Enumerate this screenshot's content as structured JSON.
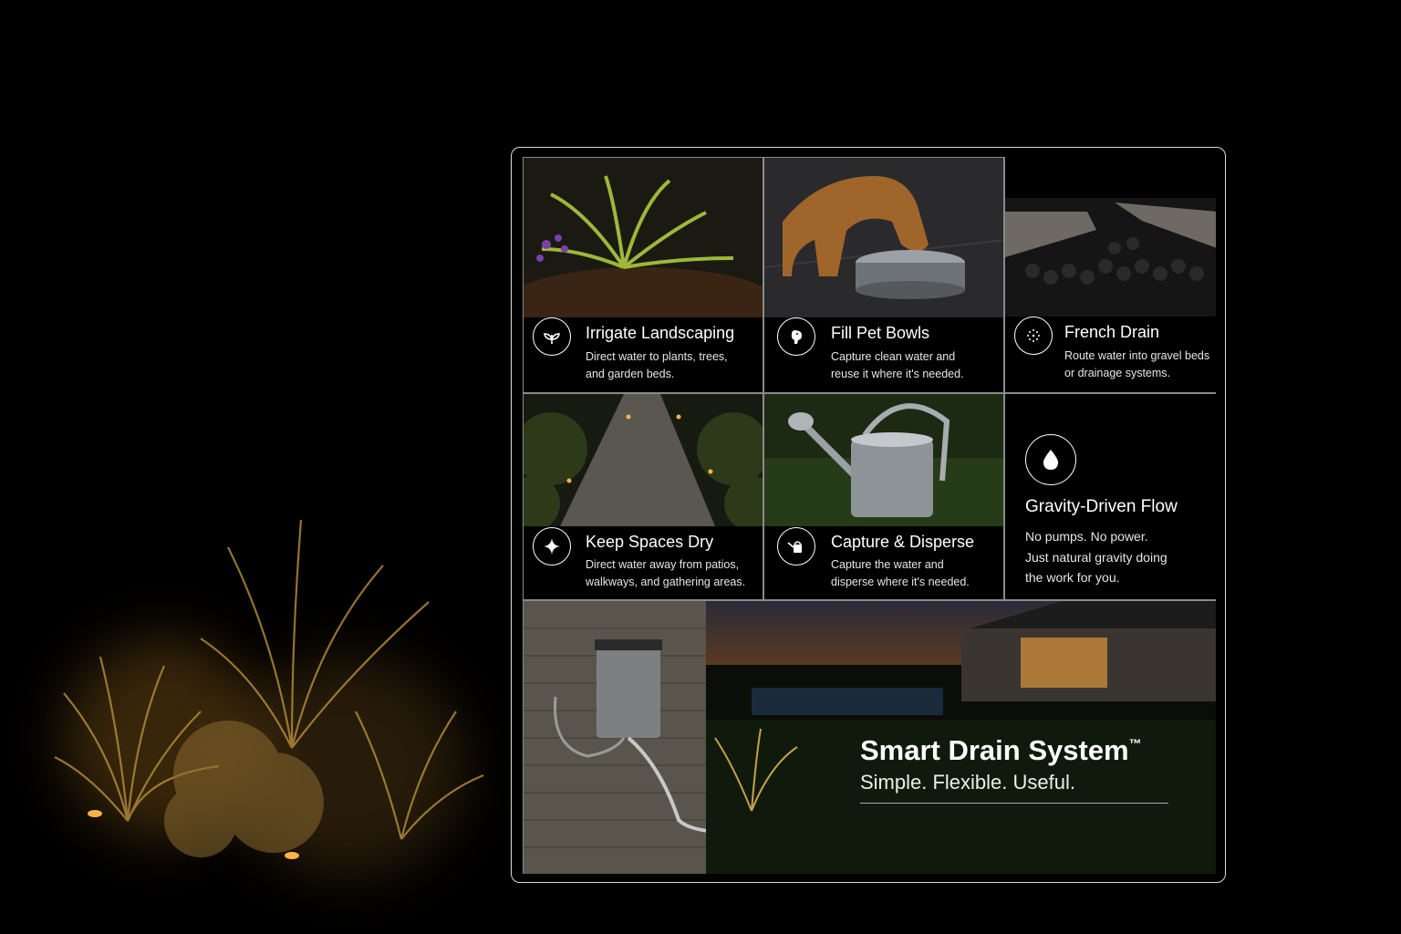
{
  "features": [
    {
      "title": "Irrigate Landscaping",
      "desc_line1": "Direct water to plants, trees,",
      "desc_line2": "and garden beds.",
      "icon": "plant-icon"
    },
    {
      "title": "Fill Pet Bowls",
      "desc_line1": "Capture clean water and",
      "desc_line2": "reuse it where it's needed.",
      "icon": "dog-icon"
    },
    {
      "title": "French Drain",
      "desc_line1": "Route water into gravel beds",
      "desc_line2": "or drainage systems.",
      "icon": "dots-circle-icon"
    },
    {
      "title": "Keep Spaces Dry",
      "desc_line1": "Direct water away from patios,",
      "desc_line2": "walkways, and gathering areas.",
      "icon": "sparkle-icon"
    },
    {
      "title": "Capture & Disperse",
      "desc_line1": "Capture the water and",
      "desc_line2": "disperse where it's needed.",
      "icon": "watering-can-icon"
    }
  ],
  "gravity": {
    "title": "Gravity-Driven Flow",
    "line1": "No pumps. No power.",
    "line2": "Just natural gravity doing",
    "line3": "the work for you.",
    "icon": "water-drop-icon"
  },
  "hero": {
    "title": "Smart Drain System",
    "trademark": "™",
    "tagline": "Simple. Flexible. Useful."
  }
}
